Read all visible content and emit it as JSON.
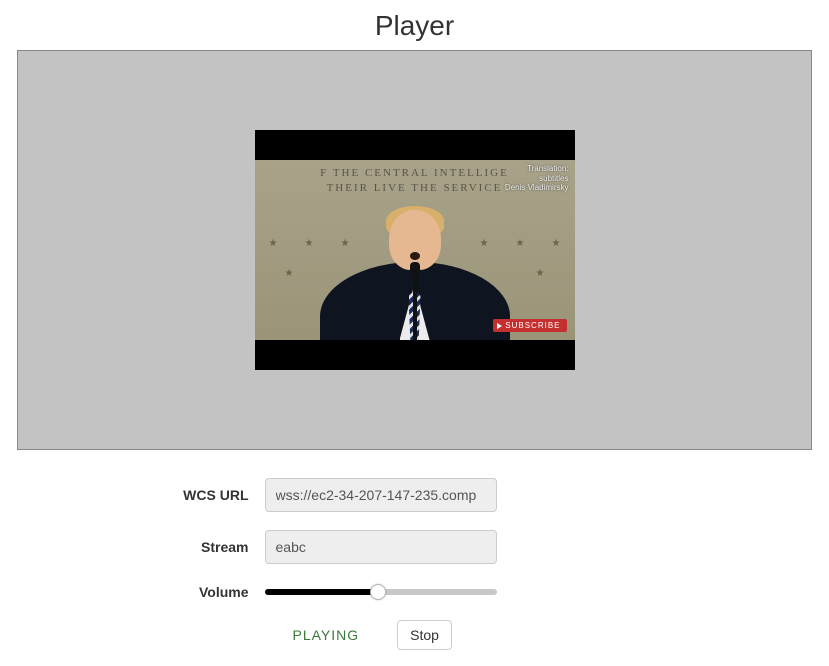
{
  "title": "Player",
  "video": {
    "wall_line1": "F THE CENTRAL INTELLIGE",
    "wall_line2": "THEIR LIVE     THE SERVICE",
    "watermark_line1": "Translation:",
    "watermark_line2": "subtitles",
    "watermark_line3": "Denis Vladimirsky",
    "subscribe_label": "SUBSCRIBE"
  },
  "form": {
    "wcs_url": {
      "label": "WCS URL",
      "value": "wss://ec2-34-207-147-235.comp"
    },
    "stream": {
      "label": "Stream",
      "value": "eabc"
    },
    "volume": {
      "label": "Volume",
      "value": 49
    }
  },
  "status": {
    "text": "PLAYING"
  },
  "buttons": {
    "stop": "Stop"
  }
}
